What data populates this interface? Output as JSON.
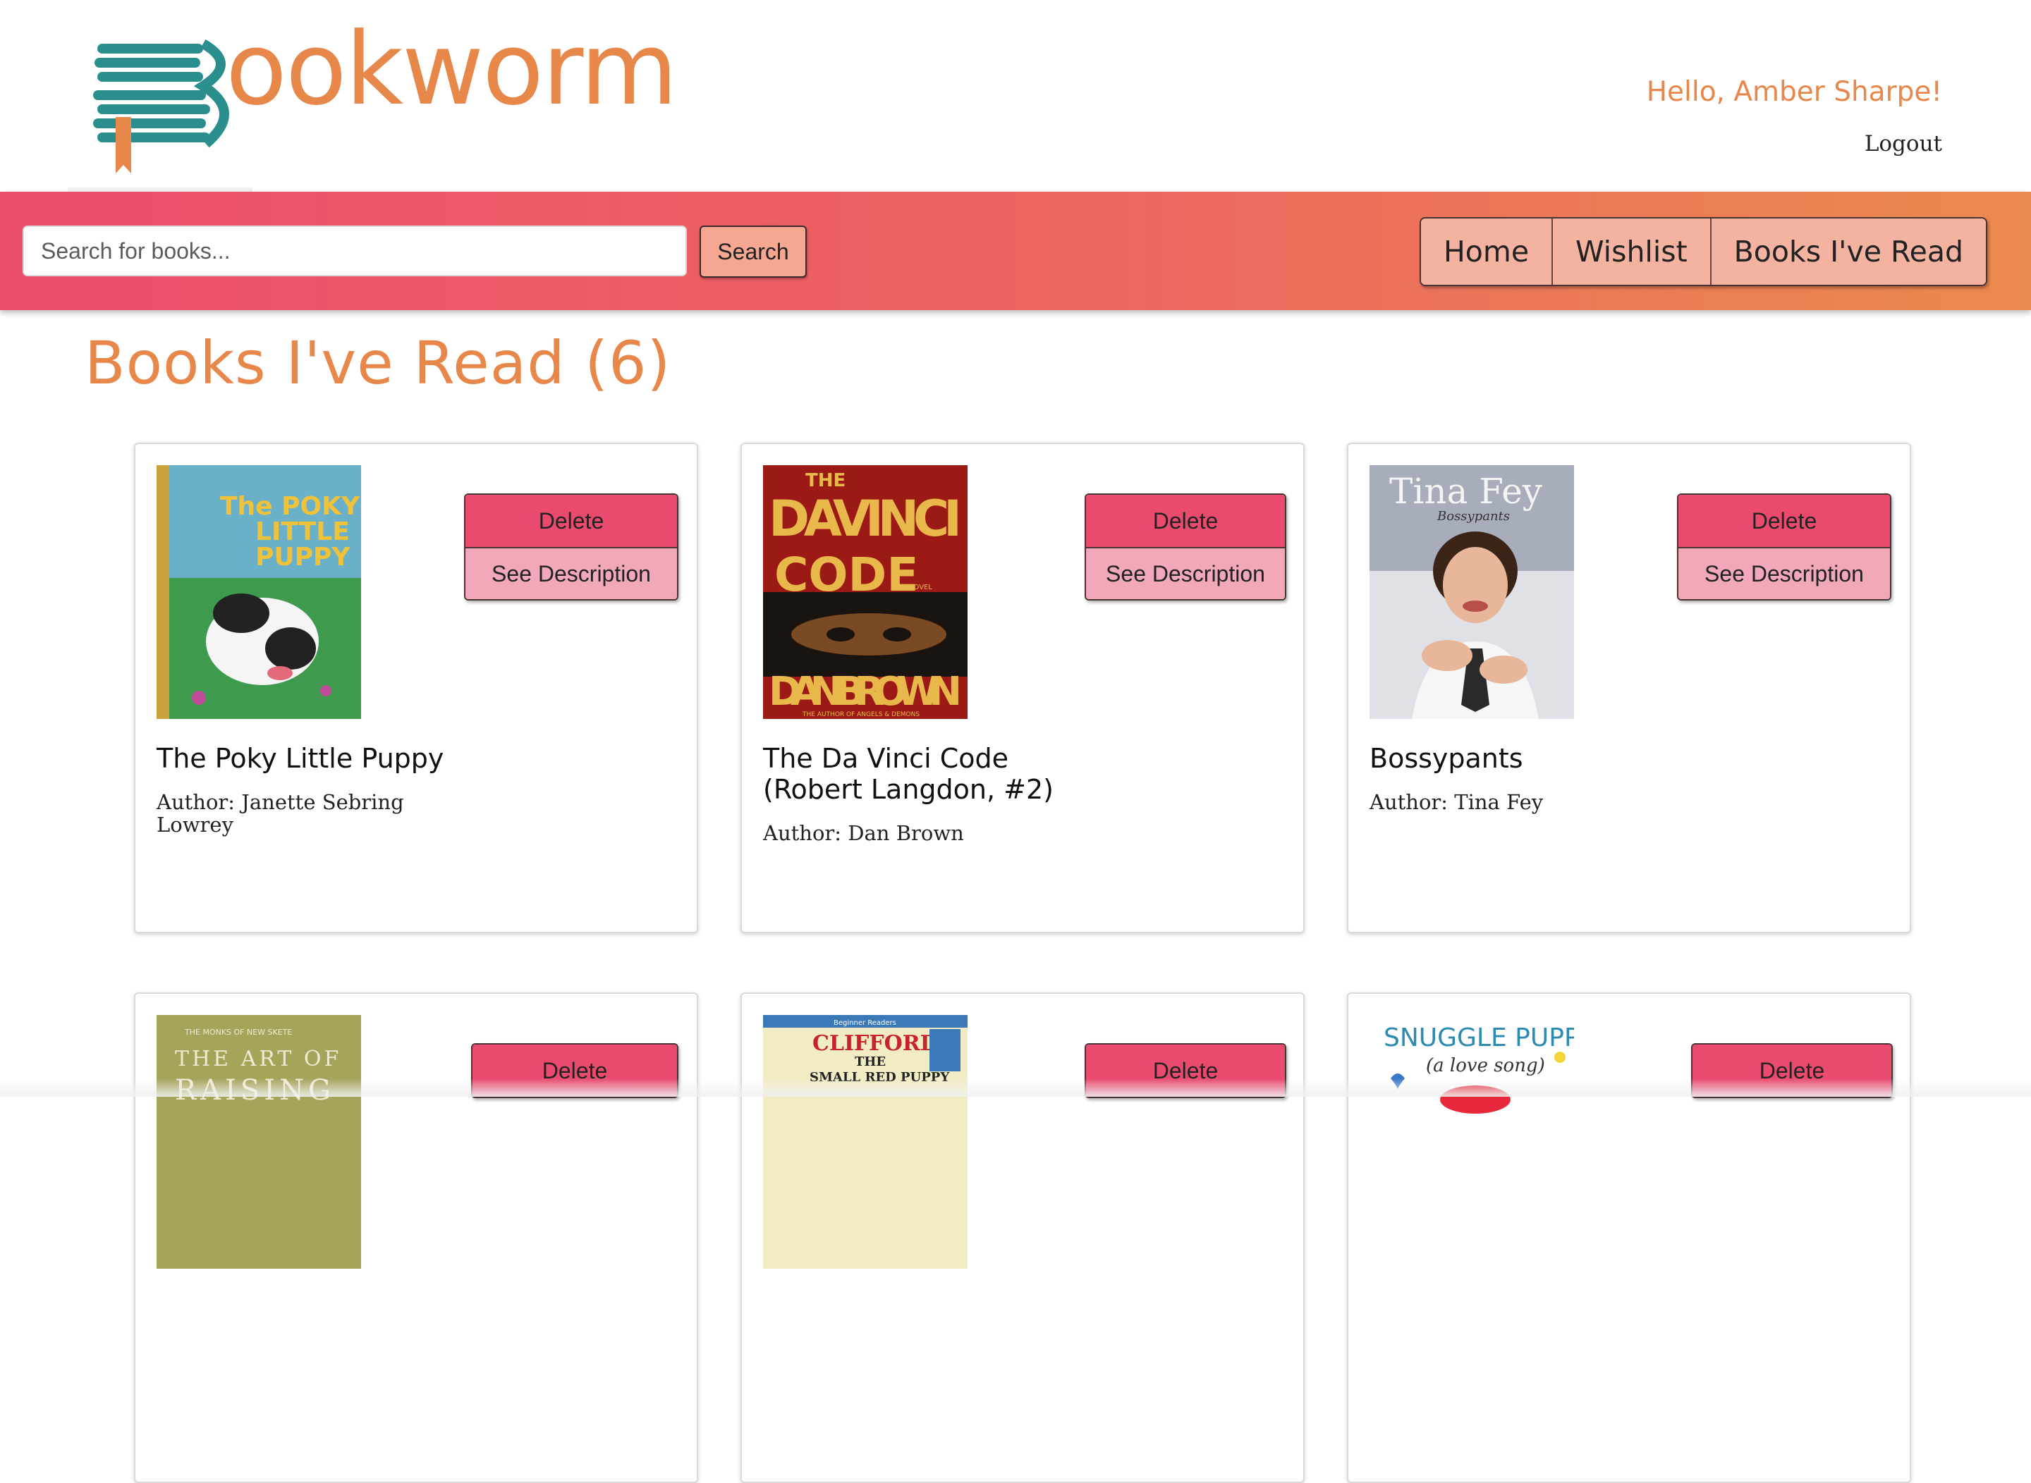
{
  "brand": {
    "name": "ookworm",
    "logo_letter": "B"
  },
  "user": {
    "greeting": "Hello, Amber Sharpe!",
    "logout_label": "Logout"
  },
  "search": {
    "placeholder": "Search for books...",
    "button_label": "Search"
  },
  "nav": {
    "home": "Home",
    "wishlist": "Wishlist",
    "read": "Books I've Read"
  },
  "page": {
    "title": "Books I've Read (6)"
  },
  "actions": {
    "delete": "Delete",
    "see_description": "See Description"
  },
  "books": [
    {
      "title": "The Poky Little Puppy",
      "author": "Author: Janette Sebring Lowrey",
      "cover_text": [
        "The POKY",
        "LITTLE",
        "PUPPY"
      ]
    },
    {
      "title": "The Da Vinci Code (Robert Langdon, #2)",
      "author": "Author: Dan Brown",
      "cover_text": [
        "THE",
        "DAVINCI",
        "CODE",
        "A NOVEL",
        "DAN BROWN",
        "THE AUTHOR OF ANGELS & DEMONS"
      ]
    },
    {
      "title": "Bossypants",
      "author": "Author: Tina Fey",
      "cover_text": [
        "Tina Fey",
        "Bossypants"
      ]
    },
    {
      "title": "",
      "author": "",
      "cover_text": [
        "THE MONKS OF NEW SKETE",
        "THE ART OF",
        "RAISING"
      ]
    },
    {
      "title": "",
      "author": "",
      "cover_text": [
        "Beginner Readers",
        "CLIFFORD",
        "THE",
        "SMALL RED PUPPY"
      ]
    },
    {
      "title": "",
      "author": "",
      "cover_text": [
        "SNUGGLE PUPPY!",
        "(a love song)"
      ]
    }
  ],
  "colors": {
    "accent_orange": "#e8874a",
    "delete_pink": "#ea4a6e",
    "desc_pink": "#f1a8b9"
  }
}
